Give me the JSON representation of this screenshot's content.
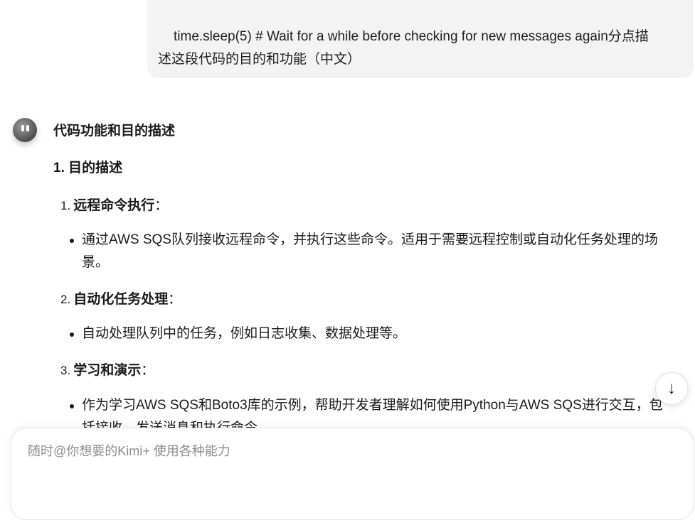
{
  "user_message": {
    "line1": "time.sleep(5)  # Wait for a while before checking for new messages again分点描",
    "line2": "述这段代码的目的和功能（中文）"
  },
  "assistant": {
    "avatar_icon": "kimi-avatar-icon",
    "heading": "代码功能和目的描述",
    "section_title": "1. 目的描述",
    "items": [
      {
        "number": "1.",
        "title": "远程命令执行",
        "suffix": "：",
        "bullets": [
          "通过AWS SQS队列接收远程命令，并执行这些命令。适用于需要远程控制或自动化任务处理的场景。"
        ]
      },
      {
        "number": "2.",
        "title": "自动化任务处理",
        "suffix": "：",
        "bullets": [
          "自动处理队列中的任务，例如日志收集、数据处理等。"
        ]
      },
      {
        "number": "3.",
        "title": "学习和演示",
        "suffix": "：",
        "bullets": [
          "作为学习AWS SQS和Boto3库的示例，帮助开发者理解如何使用Python与AWS SQS进行交互，包括接收、发送消息和执行命令。"
        ]
      }
    ]
  },
  "scroll_button": {
    "icon": "arrow-down-icon",
    "glyph": "↓"
  },
  "composer": {
    "placeholder": "随时@你想要的Kimi+ 使用各种能力"
  }
}
